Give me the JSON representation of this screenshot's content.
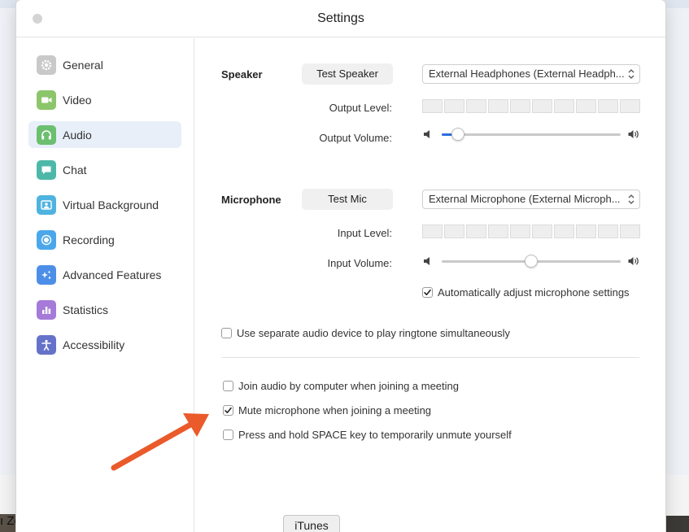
{
  "window": {
    "title": "Settings"
  },
  "sidebar": {
    "items": [
      {
        "label": "General",
        "icon": "gear-icon",
        "color": "#c9c9c9",
        "active": false
      },
      {
        "label": "Video",
        "icon": "video-camera-icon",
        "color": "#8cc56a",
        "active": false
      },
      {
        "label": "Audio",
        "icon": "headphones-icon",
        "color": "#6cbf6f",
        "active": true
      },
      {
        "label": "Chat",
        "icon": "chat-bubble-icon",
        "color": "#4db8a8",
        "active": false
      },
      {
        "label": "Virtual Background",
        "icon": "person-frame-icon",
        "color": "#4fb3e0",
        "active": false
      },
      {
        "label": "Recording",
        "icon": "record-icon",
        "color": "#4aa7ea",
        "active": false
      },
      {
        "label": "Advanced Features",
        "icon": "sparkle-icon",
        "color": "#4d8fe8",
        "active": false
      },
      {
        "label": "Statistics",
        "icon": "bar-chart-icon",
        "color": "#a67ad8",
        "active": false
      },
      {
        "label": "Accessibility",
        "icon": "accessibility-icon",
        "color": "#6672c9",
        "active": false
      }
    ]
  },
  "speaker": {
    "label": "Speaker",
    "test_button": "Test Speaker",
    "device": "External Headphones (External Headph...",
    "output_level_label": "Output Level:",
    "output_volume_label": "Output Volume:",
    "volume": 0.09
  },
  "microphone": {
    "label": "Microphone",
    "test_button": "Test Mic",
    "device": "External Microphone (External Microph...",
    "input_level_label": "Input Level:",
    "input_volume_label": "Input Volume:",
    "volume": 0.5,
    "auto_adjust": {
      "label": "Automatically adjust microphone settings",
      "checked": true
    }
  },
  "options": {
    "separate_ringtone": {
      "label": "Use separate audio device to play ringtone simultaneously",
      "checked": false
    },
    "join_audio": {
      "label": "Join audio by computer when joining a meeting",
      "checked": false
    },
    "mute_on_join": {
      "label": "Mute microphone when joining a meeting",
      "checked": true
    },
    "space_unmute": {
      "label": "Press and hold SPACE key to temporarily unmute yourself",
      "checked": false
    }
  },
  "dock_tooltip": "iTunes",
  "backdrop_text": "ı Zo",
  "colors": {
    "accent": "#2d6ce0",
    "annotation_arrow": "#ea5a2a",
    "active_item_bg": "#e8eff9"
  }
}
